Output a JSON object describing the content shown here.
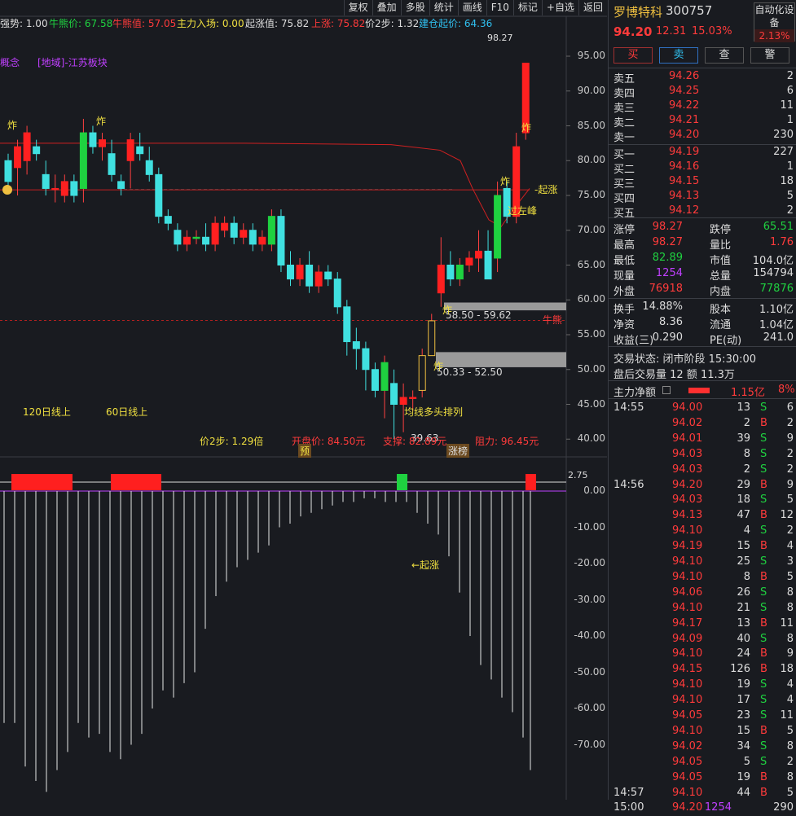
{
  "toolbar": {
    "items": [
      "复权",
      "叠加",
      "多股",
      "统计",
      "画线",
      "F10",
      "标记",
      "+自选",
      "返回"
    ]
  },
  "indicators": {
    "qiangshi": "强势: 1.00",
    "niuxiong": "牛熊价: 67.58",
    "niuxiongzhi": "牛熊值: 57.05",
    "zhuli": "主力入场: 0.00",
    "qizhang": "起涨值: 75.82",
    "shangzhang": "上涨: 75.82",
    "jia2bu": "价2步: 1.32",
    "jiancang": "建仓起价: 64.36"
  },
  "chart": {
    "concept": "概念",
    "region": "[地域]-江苏板块",
    "peak": "98.27",
    "zha": "炸",
    "qizhang": "-起涨",
    "guozuofeng": "过左峰",
    "niuxiong": "牛熊",
    "zone1": "58.50 - 59.62",
    "zone2": "50.33 - 52.50",
    "duotou": "均线多头排列",
    "low": "39.63",
    "ma120": "120日线上",
    "ma60": "60日线上",
    "jia2bu": "价2步: 1.29倍",
    "kaipan": "开盘价: 84.50元",
    "zhicheng": "支撑: 82.89元",
    "zuli": "阻力: 96.45元",
    "yu": "预",
    "zhangbang": "涨榜",
    "qizhang2": "←起涨",
    "subtop": "2.75"
  },
  "axis": {
    "main": [
      "95.00",
      "90.00",
      "85.00",
      "80.00",
      "75.00",
      "70.00",
      "65.00",
      "60.00",
      "55.00",
      "50.00",
      "45.00",
      "40.00"
    ],
    "sub": [
      "0.00",
      "-10.00",
      "-20.00",
      "-30.00",
      "-40.00",
      "-50.00",
      "-60.00",
      "-70.00"
    ]
  },
  "chart_data": {
    "type": "candlestick",
    "title": "",
    "ylim": [
      37,
      99
    ],
    "candles": [
      [
        80,
        81,
        76,
        77
      ],
      [
        79,
        83,
        75,
        82
      ],
      [
        80,
        85,
        78,
        84
      ],
      [
        82,
        83,
        80,
        81
      ],
      [
        78,
        80,
        75,
        76
      ],
      [
        76,
        78,
        74,
        76
      ],
      [
        75,
        78,
        74,
        77
      ],
      [
        77,
        78,
        74,
        75
      ],
      [
        76,
        86,
        74,
        84
      ],
      [
        84,
        85,
        81,
        82
      ],
      [
        82,
        84,
        80,
        83
      ],
      [
        81,
        83,
        77,
        78
      ],
      [
        77,
        78,
        75,
        76
      ],
      [
        80,
        84,
        76,
        83
      ],
      [
        82,
        84,
        80,
        81
      ],
      [
        80,
        82,
        77,
        78
      ],
      [
        78,
        79,
        71,
        72
      ],
      [
        72,
        73,
        70,
        71
      ],
      [
        70,
        71,
        67,
        68
      ],
      [
        68,
        70,
        67,
        69
      ],
      [
        69,
        70,
        68,
        69
      ],
      [
        69,
        71,
        67,
        68
      ],
      [
        68,
        72,
        67,
        71
      ],
      [
        70,
        72,
        69,
        71
      ],
      [
        71,
        72,
        68,
        69
      ],
      [
        69,
        71,
        68,
        70
      ],
      [
        70,
        71,
        67,
        68
      ],
      [
        68,
        70,
        67,
        69
      ],
      [
        68,
        73,
        67,
        72
      ],
      [
        72,
        73,
        64,
        65
      ],
      [
        65,
        67,
        62,
        63
      ],
      [
        63,
        66,
        62,
        65
      ],
      [
        65,
        67,
        61,
        62
      ],
      [
        62,
        65,
        61,
        64
      ],
      [
        64,
        65,
        62,
        63
      ],
      [
        63,
        64,
        58,
        59
      ],
      [
        59,
        60,
        52,
        54
      ],
      [
        54,
        56,
        50,
        53
      ],
      [
        53,
        54,
        47,
        50
      ],
      [
        50,
        51,
        46,
        47
      ],
      [
        47,
        52,
        43,
        51
      ],
      [
        48,
        50,
        40,
        45
      ],
      [
        45,
        48,
        41,
        46
      ],
      [
        46,
        47,
        44,
        46
      ],
      [
        47,
        53,
        46,
        52
      ],
      [
        52,
        58,
        52,
        57
      ],
      [
        61,
        69,
        59,
        65
      ],
      [
        65,
        67,
        62,
        63
      ],
      [
        63,
        66,
        62,
        65
      ],
      [
        65,
        67,
        64,
        66
      ],
      [
        66,
        70,
        64,
        67
      ],
      [
        67,
        70,
        63,
        63
      ],
      [
        66,
        77,
        64,
        75
      ],
      [
        76,
        77,
        71,
        72
      ],
      [
        72,
        84,
        71,
        82
      ],
      [
        84,
        90,
        83,
        94
      ]
    ],
    "series": [
      {
        "name": "牛熊",
        "values": [
          57.05
        ]
      }
    ]
  },
  "quote": {
    "name": "罗博特科",
    "code": "300757",
    "auto": "自动化设备",
    "price": "94.20",
    "change": "12.31",
    "pct": "15.03%",
    "autopct": "2.13%",
    "buy": "买",
    "sell": "卖",
    "check": "查",
    "alert": "警"
  },
  "asks": [
    [
      "卖五",
      "94.26",
      "2"
    ],
    [
      "卖四",
      "94.25",
      "6"
    ],
    [
      "卖三",
      "94.22",
      "11"
    ],
    [
      "卖二",
      "94.21",
      "1"
    ],
    [
      "卖一",
      "94.20",
      "230"
    ]
  ],
  "bids": [
    [
      "买一",
      "94.19",
      "227"
    ],
    [
      "买二",
      "94.16",
      "1"
    ],
    [
      "买三",
      "94.15",
      "18"
    ],
    [
      "买四",
      "94.13",
      "5"
    ],
    [
      "买五",
      "94.12",
      "2"
    ]
  ],
  "stats": [
    [
      "涨停",
      "98.27",
      "跌停",
      "65.51"
    ],
    [
      "最高",
      "98.27",
      "量比",
      "1.76"
    ],
    [
      "最低",
      "82.89",
      "市值",
      "104.0亿"
    ],
    [
      "现量",
      "1254",
      "总量",
      "154794"
    ],
    [
      "外盘",
      "76918",
      "内盘",
      "77876"
    ]
  ],
  "stats2": [
    [
      "换手",
      "14.88%",
      "股本",
      "1.10亿"
    ],
    [
      "净资",
      "8.36",
      "流通",
      "1.04亿"
    ],
    [
      "收益(三)",
      "0.290",
      "PE(动)",
      "241.0"
    ]
  ],
  "status": {
    "trade": "交易状态: 闭市阶段 15:30:00",
    "after": "盘后交易量 12 额 11.3万",
    "zhuli": "主力净额",
    "zhulival": "1.15亿",
    "zhulipct": "8%"
  },
  "ticks": [
    [
      "14:55",
      "94.00",
      "13",
      "S",
      "6"
    ],
    [
      "",
      "94.02",
      "2",
      "B",
      "2"
    ],
    [
      "",
      "94.01",
      "39",
      "S",
      "9"
    ],
    [
      "",
      "94.03",
      "8",
      "S",
      "2"
    ],
    [
      "",
      "94.03",
      "2",
      "S",
      "2"
    ],
    [
      "14:56",
      "94.20",
      "29",
      "B",
      "9"
    ],
    [
      "",
      "94.03",
      "18",
      "S",
      "5"
    ],
    [
      "",
      "94.13",
      "47",
      "B",
      "12"
    ],
    [
      "",
      "94.10",
      "4",
      "S",
      "2"
    ],
    [
      "",
      "94.19",
      "15",
      "B",
      "4"
    ],
    [
      "",
      "94.10",
      "25",
      "S",
      "3"
    ],
    [
      "",
      "94.10",
      "8",
      "B",
      "5"
    ],
    [
      "",
      "94.06",
      "26",
      "S",
      "8"
    ],
    [
      "",
      "94.10",
      "21",
      "S",
      "8"
    ],
    [
      "",
      "94.17",
      "13",
      "B",
      "11"
    ],
    [
      "",
      "94.09",
      "40",
      "S",
      "8"
    ],
    [
      "",
      "94.10",
      "24",
      "B",
      "9"
    ],
    [
      "",
      "94.15",
      "126",
      "B",
      "18"
    ],
    [
      "",
      "94.10",
      "19",
      "S",
      "4"
    ],
    [
      "",
      "94.10",
      "17",
      "S",
      "4"
    ],
    [
      "",
      "94.05",
      "23",
      "S",
      "11"
    ],
    [
      "",
      "94.10",
      "15",
      "B",
      "5"
    ],
    [
      "",
      "94.02",
      "34",
      "S",
      "8"
    ],
    [
      "",
      "94.05",
      "5",
      "S",
      "2"
    ],
    [
      "",
      "94.05",
      "19",
      "B",
      "8"
    ],
    [
      "14:57",
      "94.10",
      "44",
      "B",
      "5"
    ],
    [
      "15:00",
      "94.20",
      "1254",
      "",
      "290"
    ]
  ]
}
